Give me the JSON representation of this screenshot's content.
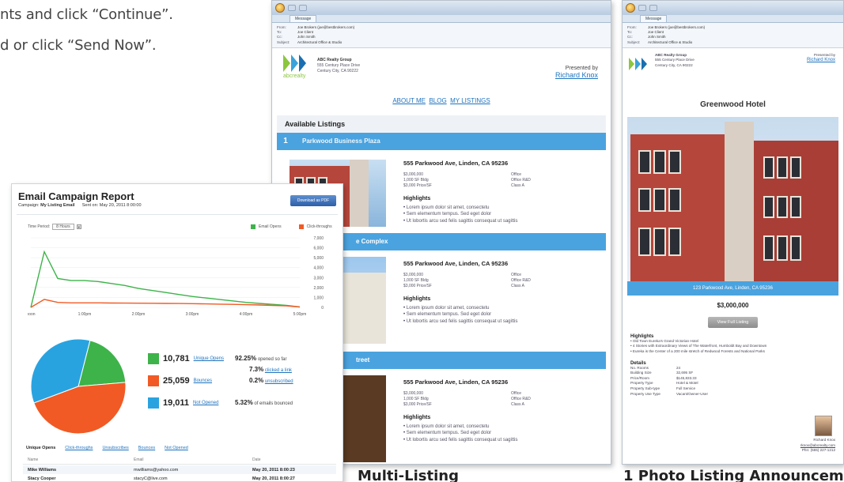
{
  "instructions": {
    "line1": "nts and click “Continue”.",
    "line2": "d or click “Send Now”."
  },
  "email_header": {
    "from_k": "From:",
    "from_v": "Joe Brokers (joe@bestbrokers.com)",
    "to_k": "To:",
    "to_v": "Joe Client",
    "cc_k": "Cc:",
    "cc_v": "John Smith",
    "subj_k": "Subject:",
    "subj_v": "Architectural Office & Studio",
    "tab": "Message"
  },
  "multi": {
    "company": "ABC Realty Group",
    "addr1": "555 Century Place Drive",
    "addr2": "Century City, CA 90222",
    "presented_by": "Presented by",
    "agent": "Richard Knox",
    "logo_text": "abcrealty",
    "nav": [
      "ABOUT ME",
      "BLOG",
      "MY LISTINGS"
    ],
    "available": "Available Listings",
    "listings": [
      {
        "num": "1",
        "name": "Parkwood Business Plaza",
        "address": "555 Parkwood Ave, Linden, CA 95236",
        "p1": "$3,000,000",
        "p2": "1,000 SF Bldg",
        "p3": "$3,000 Price/SF",
        "t1": "Office",
        "t2": "Office R&D",
        "t3": "Class A",
        "hl": "Highlights",
        "b1": "Lorem ipsum dolor sit amet, consectetu",
        "b2": "Sem elementum tempus. Sed eget dolor",
        "b3": "Ut lobortis arcu sed felis sagittis consequat ut sagittis"
      },
      {
        "name": "e Complex",
        "address": "555 Parkwood Ave, Linden, CA 95236",
        "p1": "$3,000,000",
        "p2": "1,000 SF Bldg",
        "p3": "$3,000 Price/SF",
        "t1": "Office",
        "t2": "Office R&D",
        "t3": "Class A",
        "hl": "Highlights",
        "b1": "Lorem ipsum dolor sit amet, consectetu",
        "b2": "Sem elementum tempus. Sed eget dolor",
        "b3": "Ut lobortis arcu sed felis sagittis consequat ut sagittis"
      },
      {
        "name": "treet",
        "address": "555 Parkwood Ave, Linden, CA 95236",
        "p1": "$3,000,000",
        "p2": "1,000 SF Bldg",
        "p3": "$3,000 Price/SF",
        "t1": "Office",
        "t2": "Office R&D",
        "t3": "Class A",
        "hl": "Highlights",
        "b1": "Lorem ipsum dolor sit amet, consectetu",
        "b2": "Sem elementum tempus. Sed eget dolor",
        "b3": "Ut lobortis arcu sed felis sagittis consequat ut sagittis"
      }
    ],
    "caption": "Multi-Listing"
  },
  "single": {
    "company": "ABC Realty Group",
    "addr1": "555 Century Place Drive",
    "addr2": "Century City, CA 90222",
    "presented_by": "Presented by",
    "agent": "Richard Knox",
    "hotel": "Greenwood Hotel",
    "address_bar": "123 Parkwood Ave, Linden, CA 95236",
    "price": "$3,000,000",
    "button": "View Full Listing",
    "hl": "Highlights",
    "b1": "Old Town Eureka's Grand Victorian Hotel",
    "b2": "4 Stories with Extraordinary Views of The Waterfront, Humboldt Bay and Downtown",
    "b3": "Eureka is the Center of a 200 mile stretch of Redwood Forests and National Parks",
    "details": "Details",
    "rows": [
      [
        "No. Rooms",
        "24"
      ],
      [
        "Building Size",
        "32,695 SF"
      ],
      [
        "Price/Room",
        "$145,833.33"
      ],
      [
        "Property Type",
        "Hotel & Motel"
      ],
      [
        "Property Sub-type",
        "Full Service"
      ],
      [
        "Property Use Type",
        "Vacant/Owner-User"
      ]
    ],
    "agent_name": "Richard Knox",
    "agent_email": "rknox@abcrealty.com",
    "agent_phone": "Phn: (555) 227-1212",
    "caption": "1 Photo Listing Announcem"
  },
  "report": {
    "title": "Email Campaign Report",
    "campaign_k": "Campaign:",
    "campaign_v": "My Listing Email",
    "sent": "Sent on: May 20, 2011 8:00:00",
    "download": "Download as PDF",
    "time_period_k": "Time Period:",
    "time_period_v": "8 Hours",
    "legend_open": "Email Opens",
    "legend_click": "Click-throughs",
    "yticks": [
      "7,000",
      "6,000",
      "5,000",
      "4,000",
      "3,000",
      "2,000",
      "1,000",
      "0"
    ],
    "xticks": [
      "noon",
      "1:00pm",
      "2:00pm",
      "3:00pm",
      "4:00pm",
      "5:00pm"
    ],
    "stats": [
      {
        "num": "10,781",
        "label": "Unique Opens"
      },
      {
        "num": "25,059",
        "label": "Bounces"
      },
      {
        "num": "19,011",
        "label": "Not Opened"
      }
    ],
    "pcts": [
      {
        "v": "92.25%",
        "t": "opened so far"
      },
      {
        "v": "7.3%",
        "t": "clicked a link"
      },
      {
        "v": "0.2%",
        "t": "unsubscribed"
      },
      {
        "v": "5.32%",
        "t": "of emails bounced"
      }
    ],
    "tabs": [
      "Unique Opens",
      "Click-throughs",
      "Unsubscribes",
      "Bounces",
      "Not Opened"
    ],
    "cols": [
      "Name",
      "Email",
      "Date"
    ],
    "rows": [
      [
        "Mike Williams",
        "mwilliams@yahoo.com",
        "May 20, 2011 8:00:23"
      ],
      [
        "Stacy Cooper",
        "stacyC@live.com",
        "May 20, 2011 8:00:27"
      ]
    ],
    "colors": {
      "green": "#3db34a",
      "orange": "#f15a24",
      "blue": "#29a3e0"
    }
  },
  "chart_data": {
    "type": "line",
    "x": [
      "noon",
      "",
      "",
      "",
      "1:00pm",
      "",
      "",
      "",
      "2:00pm",
      "",
      "",
      "",
      "3:00pm",
      "",
      "",
      "",
      "4:00pm",
      "",
      "",
      "",
      "5:00pm"
    ],
    "series": [
      {
        "name": "Email Opens",
        "values": [
          0,
          5600,
          2900,
          2700,
          2700,
          2600,
          2400,
          2200,
          1900,
          1700,
          1500,
          1300,
          1100,
          950,
          800,
          650,
          500,
          400,
          300,
          200,
          50
        ]
      },
      {
        "name": "Click-throughs",
        "values": [
          0,
          800,
          500,
          450,
          450,
          450,
          440,
          430,
          420,
          410,
          400,
          390,
          370,
          350,
          330,
          300,
          270,
          240,
          200,
          150,
          40
        ]
      }
    ],
    "ylim": [
      0,
      7000
    ]
  },
  "pie": {
    "values": [
      10781,
      25059,
      19011
    ],
    "labels": [
      "Unique Opens",
      "Bounces",
      "Not Opened"
    ]
  }
}
